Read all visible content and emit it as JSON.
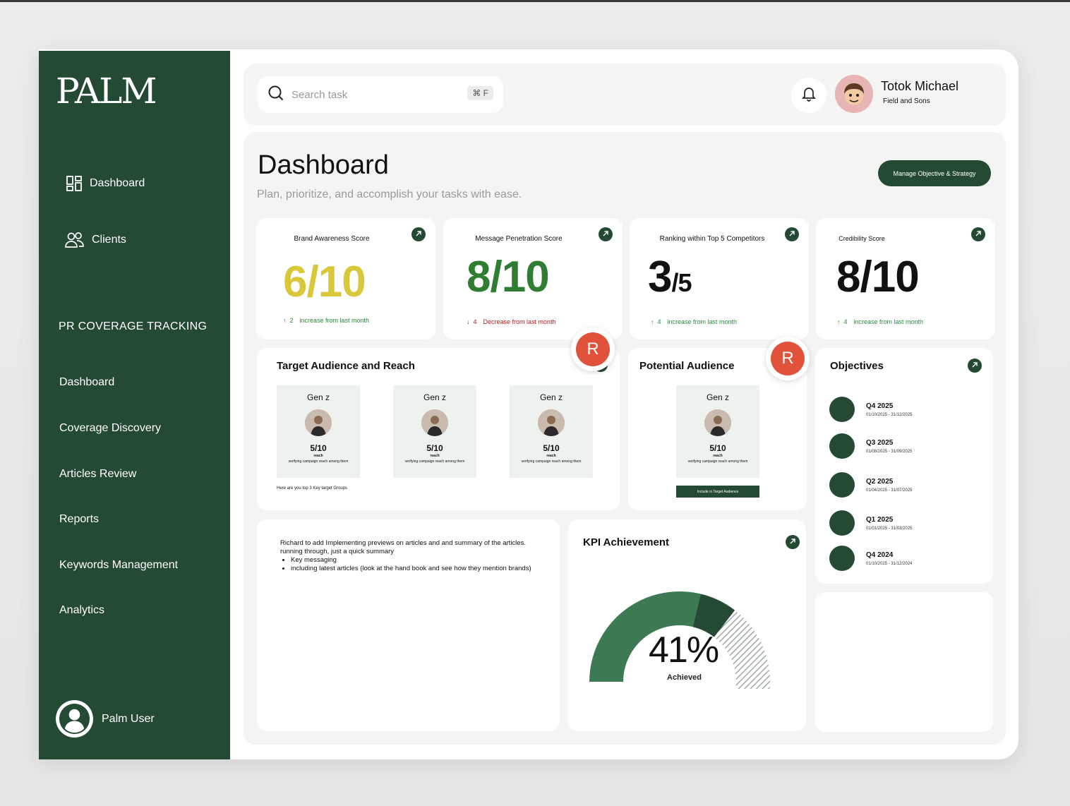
{
  "app": {
    "logo": "PALM"
  },
  "sidebar": {
    "main_items": [
      {
        "label": "Dashboard",
        "icon": "grid-icon"
      },
      {
        "label": "Clients",
        "icon": "users-icon"
      }
    ],
    "section_title": "PR COVERAGE TRACKING",
    "sub_items": [
      {
        "label": "Dashboard"
      },
      {
        "label": "Coverage Discovery"
      },
      {
        "label": "Articles Review"
      },
      {
        "label": "Reports"
      },
      {
        "label": "Keywords Management"
      },
      {
        "label": "Analytics"
      }
    ],
    "user": {
      "name": "Palm User"
    }
  },
  "header": {
    "search_placeholder": "Search task",
    "shortcut": "⌘ F",
    "profile_name": "Totok Michael",
    "profile_org": "Field and Sons"
  },
  "page": {
    "title": "Dashboard",
    "subtitle": "Plan, prioritize, and accomplish your tasks with ease.",
    "manage_button": "Manage Objective & Strategy"
  },
  "metrics": [
    {
      "label": "Brand Awareness Score",
      "value_main": "6/10",
      "value_suffix": "",
      "delta": "2",
      "note": "increase from last month",
      "direction": "up",
      "value_color": "#d9c83a",
      "note_color": "#2e8b3e"
    },
    {
      "label": "Message Penetration Score",
      "value_main": "8/10",
      "value_suffix": "",
      "delta": "4",
      "note": "Decrease from last month",
      "direction": "down",
      "value_color": "#2e7d32",
      "note_color": "#b71c1c"
    },
    {
      "label": "Ranking within Top 5 Competitors",
      "value_main": "3",
      "value_suffix": "/5",
      "delta": "4",
      "note": "increase from last month",
      "direction": "up",
      "value_color": "#111111",
      "note_color": "#2e8b3e"
    },
    {
      "label": "Credibility Score",
      "value_main": "8/10",
      "value_suffix": "",
      "delta": "4",
      "note": "increase from last month",
      "direction": "up",
      "value_color": "#111111",
      "note_color": "#2e8b3e"
    }
  ],
  "target_audience": {
    "title": "Target Audience and Reach",
    "badge": "R",
    "tiles": [
      {
        "gen": "Gen z",
        "score": "5/10",
        "reach": "reach",
        "desc": "verifying campaign reach among them"
      },
      {
        "gen": "Gen z",
        "score": "5/10",
        "reach": "reach",
        "desc": "verifying campaign reach among them"
      },
      {
        "gen": "Gen z",
        "score": "5/10",
        "reach": "reach",
        "desc": "verifying campaign reach among them"
      }
    ],
    "footer": "Here are you top 3 Key target Groups"
  },
  "potential_audience": {
    "title": "Potential Audience",
    "badge": "R",
    "tile": {
      "gen": "Gen z",
      "score": "5/10",
      "reach": "reach",
      "desc": "verifying campaign reach among them"
    },
    "button": "Include in Target Audience"
  },
  "objectives": {
    "title": "Objectives",
    "items": [
      {
        "quarter": "Q4 2025",
        "dates": "01/10/2025 - 31/12/2025"
      },
      {
        "quarter": "Q3 2025",
        "dates": "01/08/2025 - 31/09/2025"
      },
      {
        "quarter": "Q2 2025",
        "dates": "01/04/2025 - 31/07/2025"
      },
      {
        "quarter": "Q1 2025",
        "dates": "01/01/2025 - 31/03/2025"
      },
      {
        "quarter": "Q4 2024",
        "dates": "01/10/2025 - 31/12/2024"
      }
    ]
  },
  "notes": {
    "intro": "Richard to add Implementing previews on articles and and summary of the articles. running through, just a quick summary",
    "bullets": [
      "Key messaging",
      "including latest articles (look at the hand book and see how they mention brands)"
    ]
  },
  "kpi": {
    "title": "KPI Achievement",
    "percent": "41%",
    "label": "Achieved",
    "achieved_fraction": 0.41
  },
  "colors": {
    "brand": "#244a34",
    "accent_red": "#e0533a"
  }
}
